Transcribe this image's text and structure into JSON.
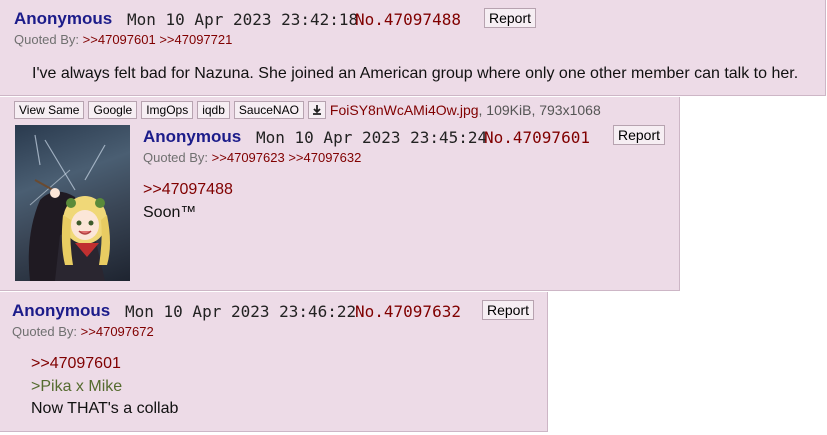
{
  "posts": [
    {
      "name": "Anonymous",
      "date": "Mon 10 Apr 2023 23:42:18",
      "number": "No.47097488",
      "report_label": "Report",
      "quoted_by_label": "Quoted By:",
      "quoted_by": [
        ">>47097601",
        ">>47097721"
      ],
      "body": [
        "I've always felt bad for Nazuna. She joined an American group where only one other member can talk to her."
      ]
    },
    {
      "file_tools": [
        "View Same",
        "Google",
        "ImgOps",
        "iqdb",
        "SauceNAO"
      ],
      "file_name": "FoiSY8nWcAMi4Ow.jpg",
      "file_meta": ", 109KiB, 793x1068",
      "name": "Anonymous",
      "date": "Mon 10 Apr 2023 23:45:24",
      "number": "No.47097601",
      "report_label": "Report",
      "quoted_by_label": "Quoted By:",
      "quoted_by": [
        ">>47097623",
        ">>47097632"
      ],
      "body": [
        ">>47097488",
        "Soon™"
      ]
    },
    {
      "name": "Anonymous",
      "date": "Mon 10 Apr 2023 23:46:22",
      "number": "No.47097632",
      "report_label": "Report",
      "quoted_by_label": "Quoted By:",
      "quoted_by": [
        ">>47097672"
      ],
      "body": [
        ">>47097601",
        ">Pika x Mike",
        "Now THAT's a collab"
      ]
    }
  ],
  "colors": {
    "post_bg": "#eddbe7",
    "name": "#1c1c8a",
    "link": "#800000",
    "greentext": "#556b2f"
  },
  "icons": {
    "download": "download-icon"
  }
}
